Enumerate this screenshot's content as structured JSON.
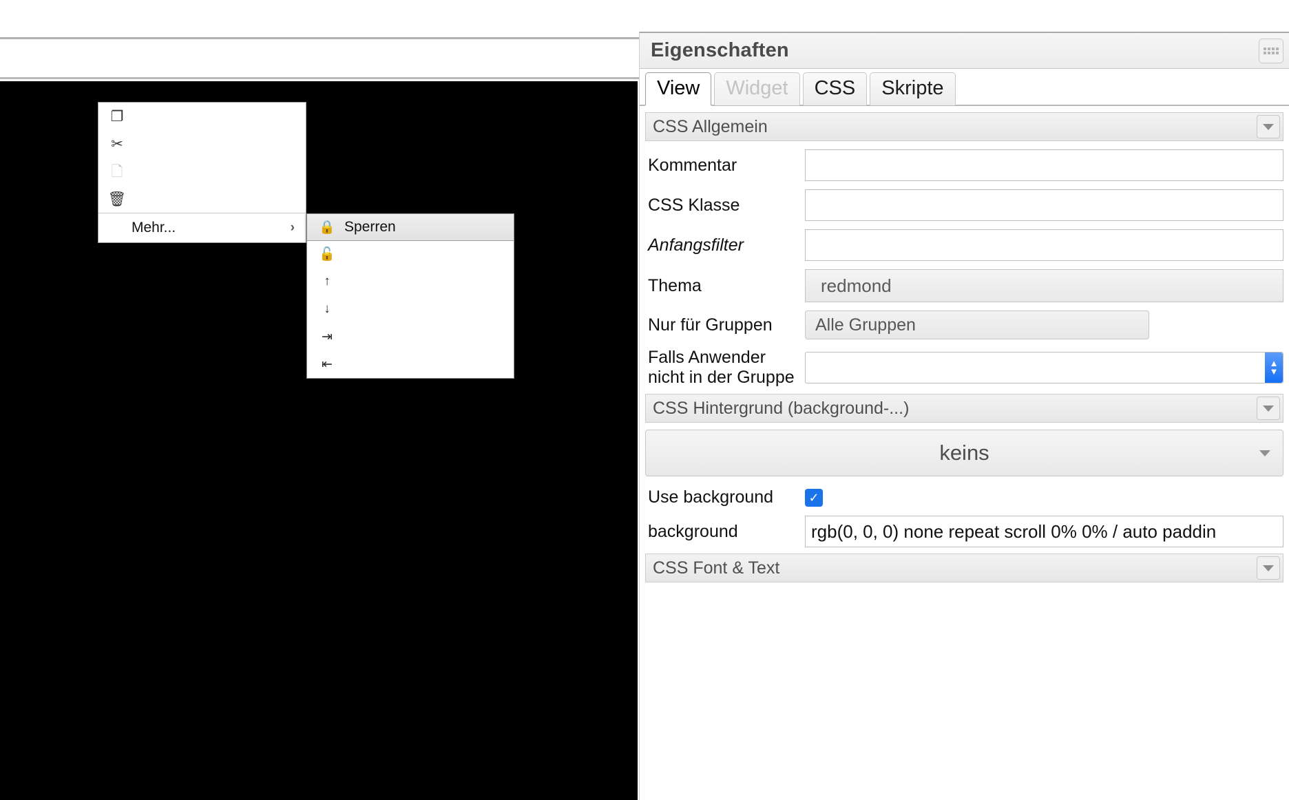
{
  "canvas": {
    "background_color": "#000000",
    "context_menu": {
      "items": [
        {
          "icon": "copy-icon",
          "glyph": "❐",
          "label": "",
          "disabled": false
        },
        {
          "icon": "cut-icon",
          "glyph": "✂",
          "label": "",
          "disabled": false
        },
        {
          "icon": "paste-icon",
          "glyph": "🗋",
          "label": "",
          "disabled": true
        },
        {
          "icon": "delete-icon",
          "glyph": "🗑",
          "label": "",
          "disabled": false
        }
      ],
      "more_label": "Mehr...",
      "more_chevron": "›"
    },
    "submenu": {
      "items": [
        {
          "icon": "lock-icon",
          "glyph": "🔒",
          "label": "Sperren",
          "highlighted": true
        },
        {
          "icon": "unlock-icon",
          "glyph": "🔓",
          "label": "",
          "highlighted": false
        },
        {
          "icon": "arrow-up-icon",
          "glyph": "↑",
          "label": "",
          "highlighted": false
        },
        {
          "icon": "arrow-down-icon",
          "glyph": "↓",
          "label": "",
          "highlighted": false
        },
        {
          "icon": "move-to-end-icon",
          "glyph": "⇥",
          "label": "",
          "highlighted": false
        },
        {
          "icon": "move-to-start-icon",
          "glyph": "⇤",
          "label": "",
          "highlighted": false
        }
      ]
    }
  },
  "panel": {
    "title": "Eigenschaften",
    "grip": "grip-handle-icon",
    "tabs": [
      {
        "label": "View",
        "state": "active"
      },
      {
        "label": "Widget",
        "state": "disabled"
      },
      {
        "label": "CSS",
        "state": "normal"
      },
      {
        "label": "Skripte",
        "state": "normal"
      }
    ],
    "sections": {
      "general": {
        "title": "CSS Allgemein",
        "fields": {
          "kommentar": {
            "label": "Kommentar",
            "value": ""
          },
          "css_klasse": {
            "label": "CSS Klasse",
            "value": ""
          },
          "anfangsfilter": {
            "label": "Anfangsfilter",
            "value": ""
          },
          "thema": {
            "label": "Thema",
            "value": "redmond"
          },
          "nur_fuer_gruppen": {
            "label": "Nur für Gruppen",
            "value": "Alle Gruppen"
          },
          "falls_anwender": {
            "label": "Falls Anwender nicht in der Gruppe",
            "value": ""
          }
        }
      },
      "background": {
        "title": "CSS Hintergrund (background-...)",
        "preset": "keins",
        "use_background": {
          "label": "Use background",
          "checked": true,
          "check_glyph": "✓",
          "color": "#1a73e8"
        },
        "background": {
          "label": "background",
          "value": "rgb(0, 0, 0) none repeat scroll 0% 0% / auto paddin"
        }
      },
      "font_text": {
        "title": "CSS Font & Text"
      }
    }
  }
}
